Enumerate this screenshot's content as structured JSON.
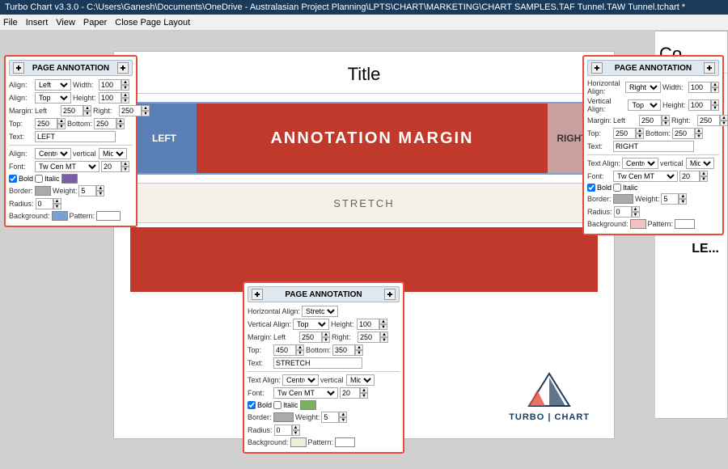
{
  "titlebar": {
    "text": "Turbo Chart v3.3.0 - C:\\Users\\Ganesh\\Documents\\OneDrive - Australasian Project Planning\\LPTS\\CHART\\MARKETING\\CHART SAMPLES.TAF Tunnel.TAW Tunnel.tchart *"
  },
  "menubar": {
    "items": [
      "File",
      "Insert",
      "View",
      "Paper",
      "Close Page Layout"
    ]
  },
  "page": {
    "title": "Title",
    "right_edge_title": "Co...",
    "annotation_left": "LEFT",
    "annotation_center": "ANNOTATION MARGIN",
    "annotation_right": "RIGHT",
    "stretch_text": "STRETCH"
  },
  "panel_left": {
    "header": "PAGE ANNOTATION",
    "h_align_label": "Align:",
    "h_align_value": "Left",
    "width_label": "Width:",
    "width_value": "100",
    "v_align_label": "Align:",
    "v_align_value": "Top",
    "height_label": "Height:",
    "height_value": "100",
    "margin_label": "Margin:",
    "left_label": "Left",
    "left_value": "250",
    "right_label": "Right:",
    "right_value": "250",
    "top_label": "Top:",
    "top_value": "250",
    "bottom_label": "Bottom:",
    "bottom_value": "250",
    "text_label": "Text:",
    "text_value": "LEFT",
    "text_align_label": "Align:",
    "text_align_value": "Centre",
    "vertical_label": "vertical",
    "vertical_value": "Middle",
    "font_label": "Font:",
    "font_value": "Tw Cen MT",
    "font_size": "20",
    "bold_label": "Bold",
    "italic_label": "Italic",
    "border_label": "Border:",
    "weight_label": "Weight:",
    "weight_value": "5",
    "radius_label": "Radius:",
    "radius_value": "0",
    "background_label": "Background:",
    "pattern_label": "Pattern:"
  },
  "panel_right": {
    "header": "PAGE ANNOTATION",
    "h_align_label": "Horizontal Align:",
    "h_align_value": "Right",
    "width_label": "Width:",
    "width_value": "100",
    "v_align_label": "Vertical Align:",
    "v_align_value": "Top",
    "height_label": "Height:",
    "height_value": "100",
    "margin_label": "Margin:",
    "left_value": "250",
    "right_value": "250",
    "top_value": "250",
    "bottom_value": "250",
    "text_label": "Text:",
    "text_value": "RIGHT",
    "text_align_label": "Text Align:",
    "text_align_value": "Centre",
    "vertical_value": "Midd",
    "font_label": "Font:",
    "font_value": "Tw Cen MT",
    "font_size": "20",
    "bold_label": "Bold",
    "italic_label": "Italic",
    "border_label": "Border:",
    "weight_label": "Weight:",
    "weight_value": "5",
    "radius_label": "Radius:",
    "radius_value": "0",
    "background_label": "Background:",
    "pattern_label": "Pattern:"
  },
  "panel_bottom": {
    "header": "PAGE ANNOTATION",
    "h_align_label": "Horizontal Align:",
    "h_align_value": "Stretch",
    "v_align_label": "Vertical Align:",
    "v_align_value": "Top",
    "height_label": "Height:",
    "height_value": "100",
    "margin_label": "Margin:",
    "left_value": "250",
    "right_value": "250",
    "top_value": "450",
    "bottom_value": "350",
    "text_label": "Text:",
    "text_value": "STRETCH",
    "text_align_label": "Text Align:",
    "text_align_value": "Centre",
    "vertical_value": "Middle",
    "font_label": "Font:",
    "font_value": "Tw Cen MT",
    "font_size": "20",
    "bold_label": "Bold",
    "italic_label": "Italic",
    "border_label": "Border:",
    "weight_label": "Weight:",
    "weight_value": "5",
    "radius_label": "Radius:",
    "radius_value": "0",
    "background_label": "Background:",
    "pattern_label": "Pattern:"
  },
  "logo": {
    "text": "TURBO | CHART"
  },
  "right_edge": {
    "le_text": "LE..."
  }
}
